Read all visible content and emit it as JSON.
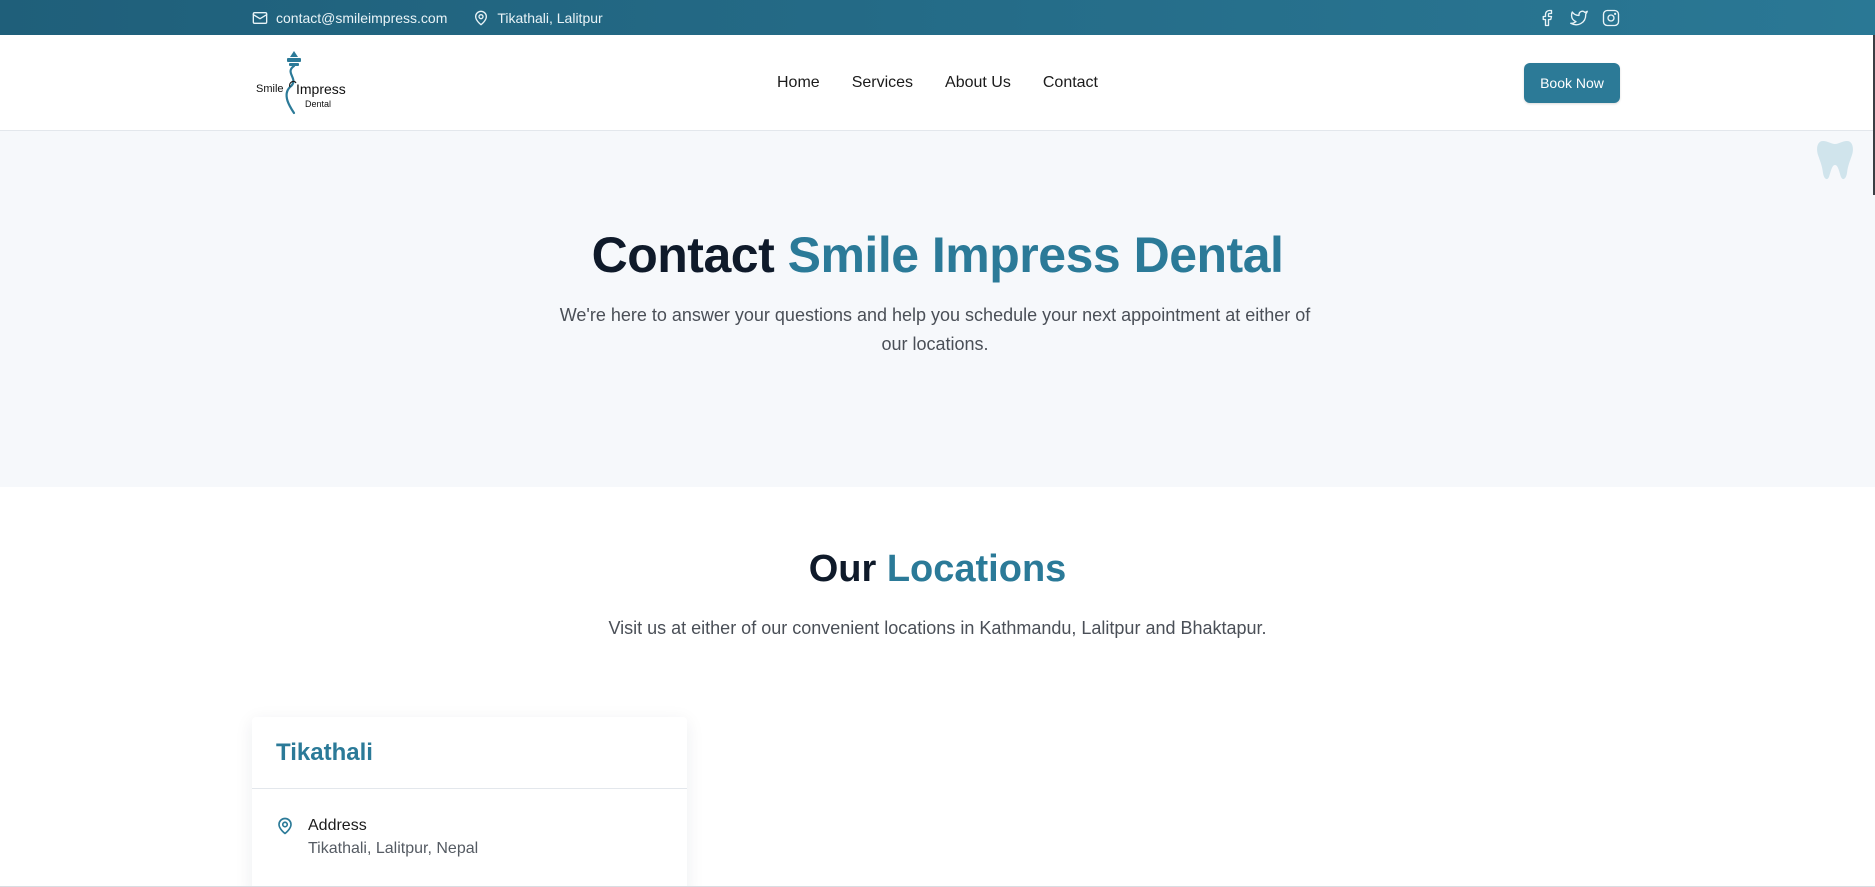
{
  "topbar": {
    "email": "contact@smileimpress.com",
    "location": "Tikathali, Lalitpur",
    "social": [
      "facebook-icon",
      "twitter-icon",
      "instagram-icon"
    ]
  },
  "navbar": {
    "logo": {
      "line1": "Smile",
      "line2": "Impress",
      "line3": "Dental"
    },
    "links": [
      "Home",
      "Services",
      "About Us",
      "Contact"
    ],
    "cta": "Book Now"
  },
  "hero": {
    "title_plain": "Contact",
    "title_accent": "Smile Impress Dental",
    "subtitle": "We're here to answer your questions and help you schedule your next appointment at either of our locations."
  },
  "locations": {
    "title_plain": "Our",
    "title_accent": "Locations",
    "subtitle": "Visit us at either of our convenient locations in Kathmandu, Lalitpur and Bhaktapur.",
    "cards": [
      {
        "name": "Tikathali",
        "address_label": "Address",
        "address": "Tikathali, Lalitpur, Nepal"
      }
    ]
  },
  "colors": {
    "brand": "#2b7a98",
    "topbar": "#1f5f7a",
    "hero_bg": "#f6f8fb",
    "heading": "#0f1a2a"
  }
}
